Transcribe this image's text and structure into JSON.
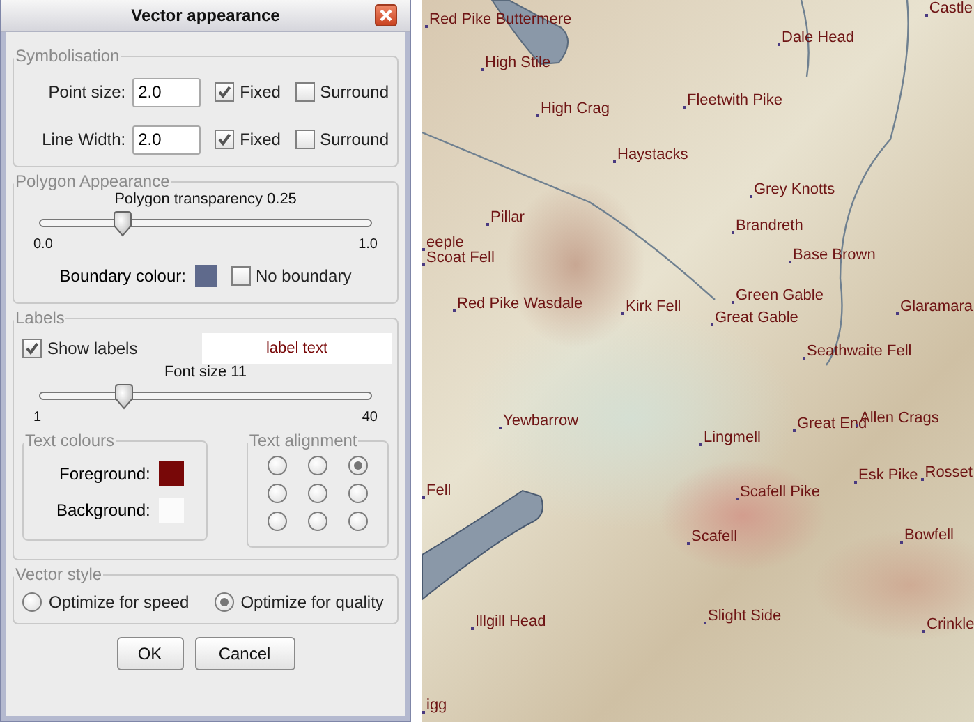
{
  "dialog": {
    "title": "Vector appearance",
    "symbolisation": {
      "legend": "Symbolisation",
      "rows": [
        {
          "label": "Point size:",
          "value": "2.0",
          "fixed": {
            "label": "Fixed",
            "checked": true
          },
          "surround": {
            "label": "Surround",
            "checked": false
          }
        },
        {
          "label": "Line Width:",
          "value": "2.0",
          "fixed": {
            "label": "Fixed",
            "checked": true
          },
          "surround": {
            "label": "Surround",
            "checked": false
          }
        }
      ]
    },
    "polygon": {
      "legend": "Polygon Appearance",
      "slider": {
        "label": "Polygon transparency 0.25",
        "level": 0.25,
        "min": "0.0",
        "max": "1.0"
      },
      "boundary": {
        "label": "Boundary colour:",
        "color": "#5f6a8c"
      },
      "no_boundary": {
        "label": "No boundary",
        "checked": false
      }
    },
    "labels": {
      "legend": "Labels",
      "show_labels": {
        "label": "Show labels",
        "checked": true
      },
      "preview": "label text",
      "slider": {
        "label": "Font size 11",
        "level": 0.256,
        "min": "1",
        "max": "40"
      },
      "text_colours": {
        "legend": "Text colours",
        "foreground": {
          "label": "Foreground:",
          "color": "#780808"
        },
        "background": {
          "label": "Background:",
          "color": "#fbfbfb"
        }
      },
      "text_alignment": {
        "legend": "Text alignment",
        "options": [
          {
            "selected": false
          },
          {
            "selected": false
          },
          {
            "selected": true
          },
          {
            "selected": false
          },
          {
            "selected": false
          },
          {
            "selected": false
          },
          {
            "selected": false
          },
          {
            "selected": false
          },
          {
            "selected": false
          }
        ]
      }
    },
    "vector_style": {
      "legend": "Vector style",
      "options": [
        {
          "label": "Optimize for speed",
          "selected": false
        },
        {
          "label": "Optimize for quality",
          "selected": true
        }
      ]
    },
    "buttons": [
      "OK",
      "Cancel"
    ]
  },
  "map": {
    "labels": [
      "Castle",
      "Red Pike Buttermere",
      "Dale Head",
      "High Stile",
      "Fleetwith Pike",
      "High Crag",
      "Haystacks",
      "Grey Knotts",
      "Pillar",
      "Brandreth",
      "eeple",
      "Scoat Fell",
      "Base Brown",
      "Red Pike Wasdale",
      "Green Gable",
      "Kirk Fell",
      "Glaramara",
      "Great Gable",
      "Seathwaite Fell",
      "Yewbarrow",
      "Great End",
      "Allen Crags",
      "Lingmell",
      "Esk Pike",
      "Rosset",
      "Fell",
      "Scafell Pike",
      "Scafell",
      "Bowfell",
      "Illgill Head",
      "Slight Side",
      "Crinkle",
      "igg"
    ]
  }
}
